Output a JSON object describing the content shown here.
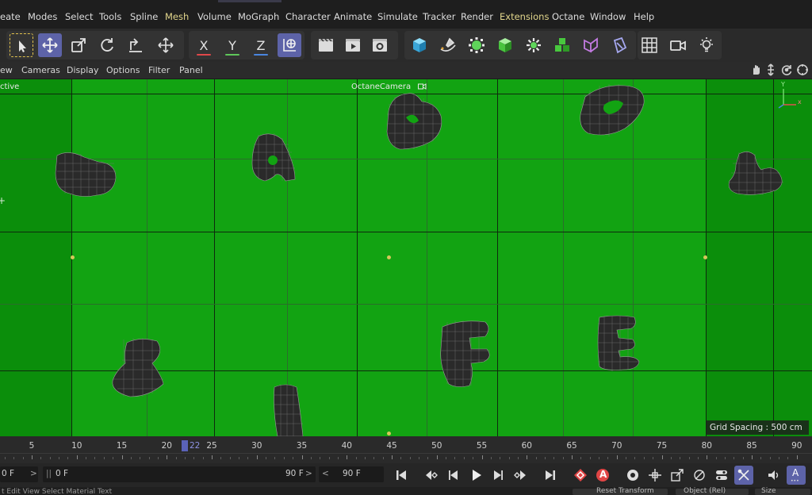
{
  "menu": {
    "items": [
      "eate",
      "Modes",
      "Select",
      "Tools",
      "Spline",
      "Mesh",
      "Volume",
      "MoGraph",
      "Character",
      "Animate",
      "Simulate",
      "Tracker",
      "Render",
      "Extensions",
      "Octane",
      "Window",
      "Help"
    ]
  },
  "toolbar": {
    "axis_x": "X",
    "axis_y": "Y",
    "axis_z": "Z",
    "accent_x": "#e0484a",
    "accent_y": "#5fc75a",
    "accent_z": "#4a86e0",
    "selected_color": "#5d63a8",
    "icons": [
      "live-selection-icon",
      "move-icon",
      "scale-icon",
      "rotate-icon",
      "transform-icon",
      "move-all-icon",
      "x-axis-icon",
      "y-axis-icon",
      "z-axis-icon",
      "world-coordinates-icon",
      "render-region-icon",
      "render-view-icon",
      "render-settings-icon",
      "cube-icon",
      "pen-icon",
      "subdivision-icon",
      "extrude-icon",
      "cloner-icon",
      "effector-icon",
      "deformer-icon",
      "field-icon",
      "floor-icon",
      "camera-icon",
      "light-icon"
    ]
  },
  "viewport_menu": {
    "items": [
      "ew",
      "Cameras",
      "Display",
      "Options",
      "Filter",
      "Panel"
    ],
    "nav_icons": [
      "pan-icon",
      "dolly-icon",
      "orbit-icon",
      "maximize-icon"
    ]
  },
  "viewport": {
    "left_label": "ctive",
    "camera_name": "OctaneCamera",
    "grid_spacing": "Grid Spacing : 500 cm",
    "background_color": "#12a312",
    "axis_labels": {
      "y": "Y",
      "x": "x"
    }
  },
  "timeline": {
    "tick_labels": [
      "5",
      "10",
      "15",
      "20",
      "25",
      "30",
      "35",
      "40",
      "45",
      "50",
      "55",
      "60",
      "65",
      "70",
      "75",
      "80",
      "85",
      "90"
    ],
    "current_frame": "22"
  },
  "transport": {
    "field_start": "0 F",
    "field_current": "0 F",
    "field_end_left": "90 F",
    "field_end_right": "90 F",
    "arrow_left": "<",
    "arrow_right": ">",
    "record_label": "A",
    "auto_key_label": "A"
  },
  "bottom_strip": {
    "text": "t   Edit   View   Select   Material   Text",
    "right_fields": [
      "Reset Transform",
      "Object (Rel)",
      "Size"
    ]
  }
}
